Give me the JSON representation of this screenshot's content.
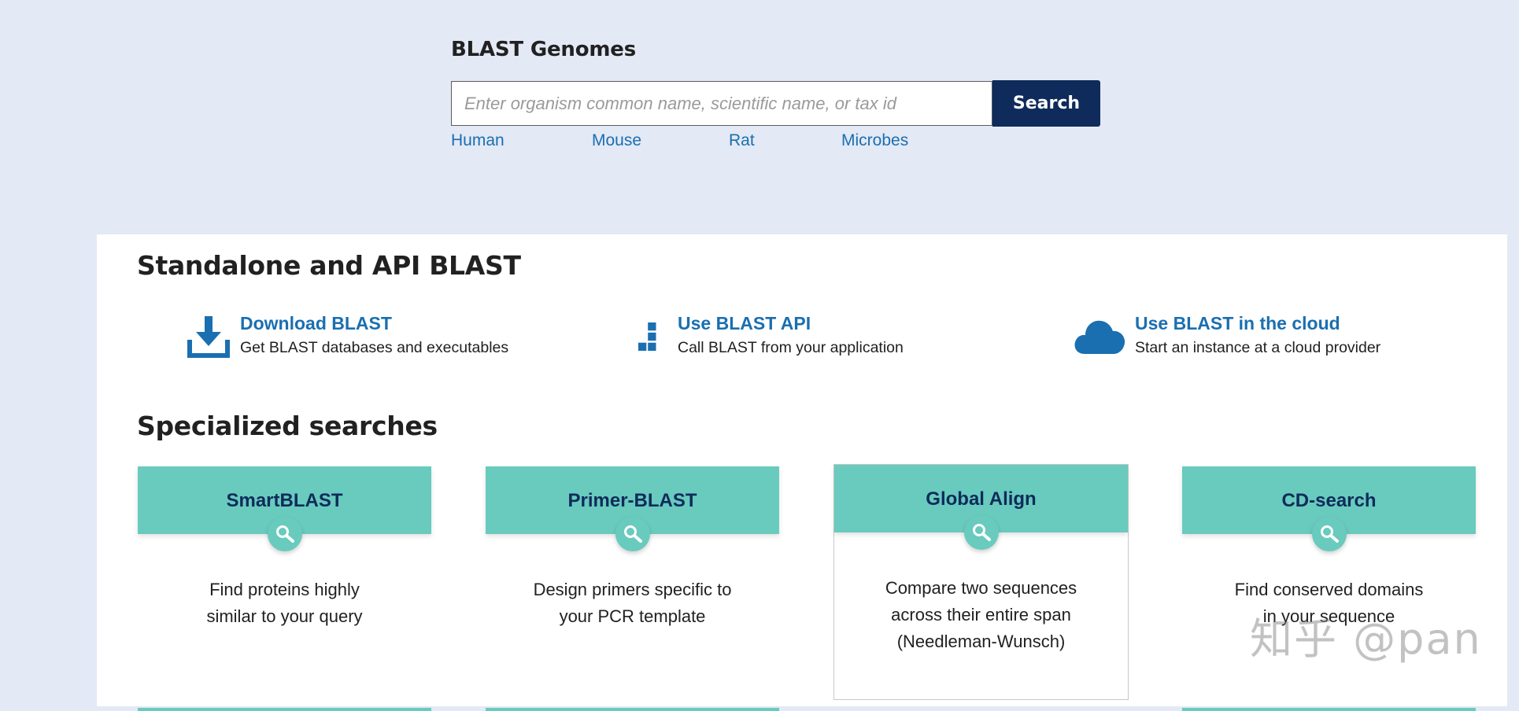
{
  "genomes": {
    "title": "BLAST Genomes",
    "search": {
      "placeholder": "Enter organism common name, scientific name, or tax id",
      "value": "",
      "button_label": "Search"
    },
    "quick_links": [
      "Human",
      "Mouse",
      "Rat",
      "Microbes"
    ]
  },
  "standalone": {
    "title": "Standalone and API BLAST",
    "tools": [
      {
        "title": "Download BLAST",
        "desc": "Get BLAST databases and executables",
        "icon": "download-icon"
      },
      {
        "title": "Use BLAST API",
        "desc": "Call BLAST from your application",
        "icon": "api-blocks-icon"
      },
      {
        "title": "Use BLAST in the cloud",
        "desc": "Start an instance at a cloud provider",
        "icon": "cloud-icon"
      }
    ]
  },
  "specialized": {
    "title": "Specialized searches",
    "cards": [
      {
        "title": "SmartBLAST",
        "line1": "Find proteins highly",
        "line2": "similar to your query",
        "line3": ""
      },
      {
        "title": "Primer-BLAST",
        "line1": "Design primers specific to",
        "line2": "your PCR template",
        "line3": ""
      },
      {
        "title": "Global Align",
        "line1": "Compare two sequences",
        "line2": "across their entire span",
        "line3": "(Needleman-Wunsch)"
      },
      {
        "title": "CD-search",
        "line1": "Find conserved domains",
        "line2": "in your sequence",
        "line3": ""
      }
    ]
  },
  "watermark": "知乎 @pan",
  "colors": {
    "page_bg": "#e3e9f5",
    "accent_teal": "#68cbbd",
    "navy": "#0f2b5b",
    "link_blue": "#1a6fb0"
  }
}
